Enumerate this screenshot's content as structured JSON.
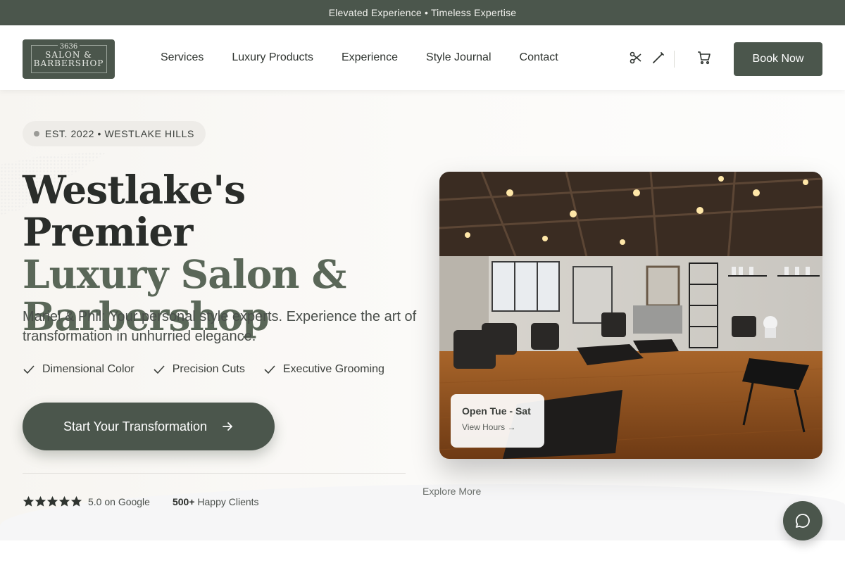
{
  "announcement": "Elevated Experience • Timeless Expertise",
  "logo": {
    "number": "3636",
    "line1": "SALON &",
    "line2": "BARBERSHOP"
  },
  "nav": {
    "items": [
      {
        "label": "Services"
      },
      {
        "label": "Luxury Products"
      },
      {
        "label": "Experience"
      },
      {
        "label": "Style Journal"
      },
      {
        "label": "Contact"
      }
    ]
  },
  "header_icons": [
    "scissors-icon",
    "razor-icon",
    "cart-icon"
  ],
  "book_button": "Book Now",
  "hero": {
    "badge": "EST. 2022 • WESTLAKE HILLS",
    "headline_line1": "Westlake's Premier",
    "headline_line2": "Luxury Salon &",
    "headline_line3": "Barbershop",
    "subtitle": "Mariel & Phil: Your personal style experts. Experience the art of transformation in unhurried elegance.",
    "features": [
      "Dimensional Color",
      "Precision Cuts",
      "Executive Grooming"
    ],
    "cta": "Start Your Transformation",
    "rating_value": "5.0 on Google",
    "stars": 5,
    "clients_count": "500+",
    "clients_label": "Happy Clients",
    "hours_title": "Open Tue - Sat",
    "hours_link": "View Hours →",
    "explore": "Explore More"
  },
  "colors": {
    "brand": "#4b564c",
    "headline_dark": "#2a2d2a",
    "headline_green": "#5a6758"
  }
}
